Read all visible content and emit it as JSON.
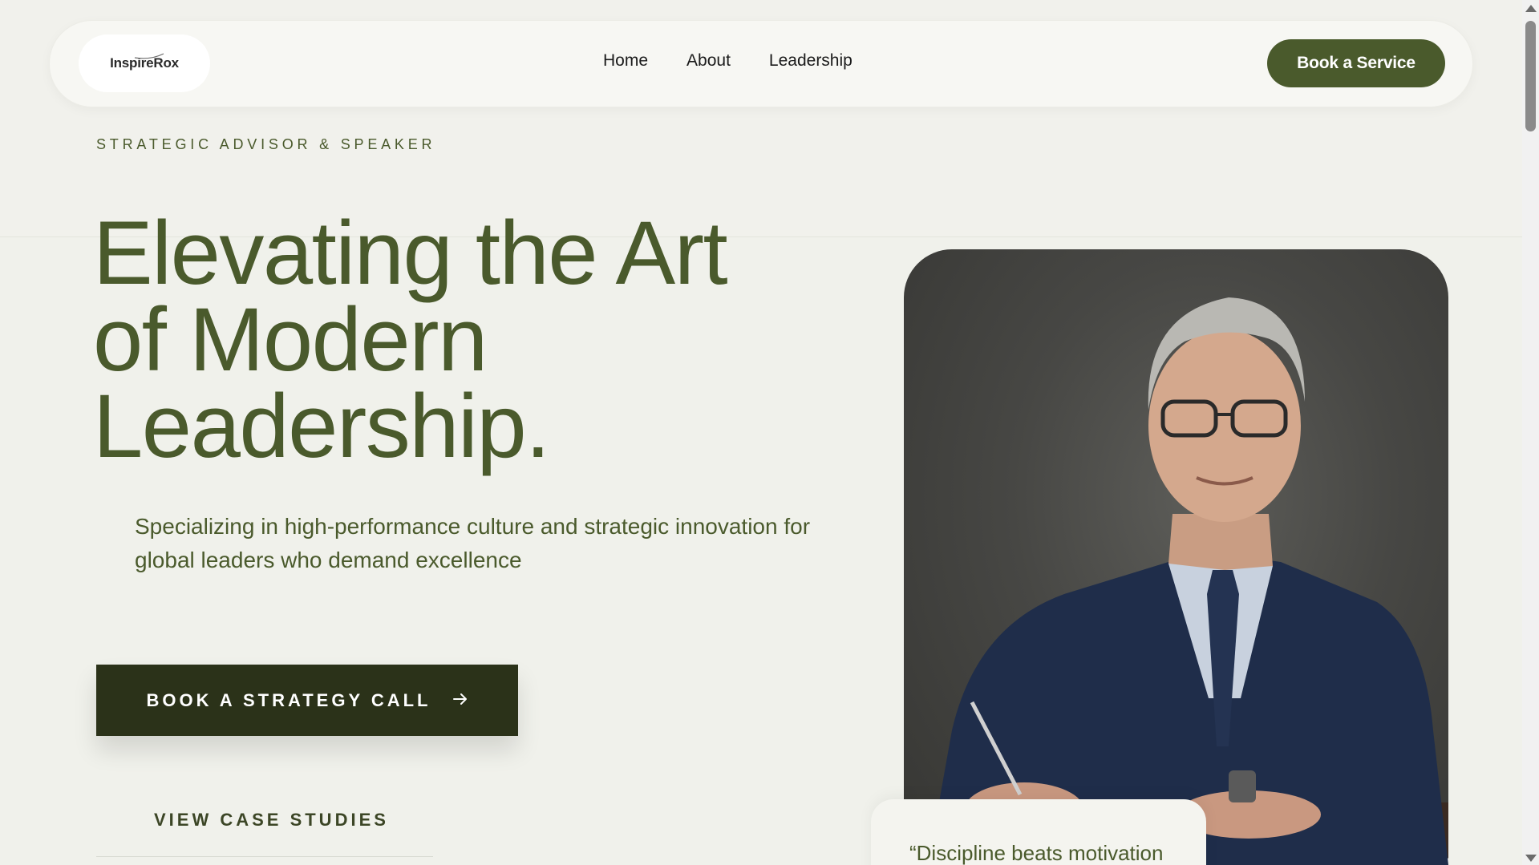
{
  "brand": {
    "name": "InspireRox"
  },
  "nav": {
    "links": [
      {
        "label": "Home"
      },
      {
        "label": "About"
      },
      {
        "label": "Leadership"
      }
    ],
    "cta_label": "Book a Service"
  },
  "hero": {
    "eyebrow": "STRATEGIC ADVISOR & SPEAKER",
    "headline_lines": [
      "Elevating the Art",
      "of Modern",
      "Leadership."
    ],
    "subcopy": "Specializing in high-performance culture and strategic innovation for global leaders who demand excellence",
    "primary_cta_label": "BOOK A STRATEGY CALL",
    "primary_cta_icon": "arrow-right-icon",
    "secondary_cta_label": "VIEW CASE STUDIES"
  },
  "portrait": {
    "subject": "man in navy suit writing at desk"
  },
  "quote": {
    "text": "“Discipline beats motivation"
  },
  "colors": {
    "page_bg": "#f1f1ec",
    "accent_olive": "#4a5a2c",
    "dark_button": "#2b3219",
    "nav_bg": "#f7f7f3"
  }
}
